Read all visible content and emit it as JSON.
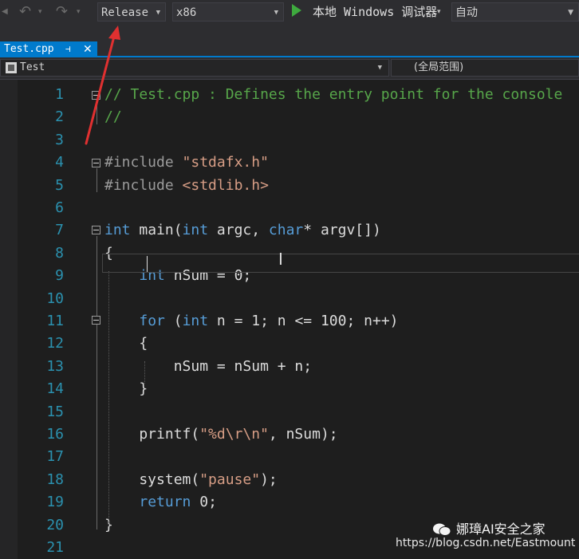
{
  "toolbar": {
    "config": "Release",
    "platform": "x86",
    "run_label": "本地 Windows 调试器",
    "run_mode": "自动",
    "undo_icon": "undo-icon",
    "redo_icon": "redo-icon",
    "start_icon": "play-icon"
  },
  "tab": {
    "title": "Test.cpp",
    "pin": "⊣",
    "close": "✕"
  },
  "navbar": {
    "scope": "Test",
    "member": "(全局范围)"
  },
  "code_lines": [
    {
      "n": "1",
      "text": "// Test.cpp : Defines the entry point for the console"
    },
    {
      "n": "2",
      "text": "//"
    },
    {
      "n": "3",
      "text": ""
    },
    {
      "n": "4",
      "text": "#include \"stdafx.h\""
    },
    {
      "n": "5",
      "text": "#include <stdlib.h>"
    },
    {
      "n": "6",
      "text": ""
    },
    {
      "n": "7",
      "text": "int main(int argc, char* argv[])"
    },
    {
      "n": "8",
      "text": "{"
    },
    {
      "n": "9",
      "text": "    int nSum = 0;"
    },
    {
      "n": "10",
      "text": ""
    },
    {
      "n": "11",
      "text": "    for (int n = 1; n <= 100; n++)"
    },
    {
      "n": "12",
      "text": "    {"
    },
    {
      "n": "13",
      "text": "        nSum = nSum + n;"
    },
    {
      "n": "14",
      "text": "    }"
    },
    {
      "n": "15",
      "text": ""
    },
    {
      "n": "16",
      "text": "    printf(\"%d\\r\\n\", nSum);"
    },
    {
      "n": "17",
      "text": ""
    },
    {
      "n": "18",
      "text": "    system(\"pause\");"
    },
    {
      "n": "19",
      "text": "    return 0;"
    },
    {
      "n": "20",
      "text": "}"
    },
    {
      "n": "21",
      "text": ""
    }
  ],
  "watermark": {
    "name": "娜璋AI安全之家",
    "url": "https://blog.csdn.net/Eastmount"
  },
  "colors": {
    "keyword": "#569cd6",
    "string": "#d69d85",
    "comment": "#57a64a",
    "line_number": "#2b91af",
    "accent": "#007acc",
    "arrow": "#e03030"
  }
}
